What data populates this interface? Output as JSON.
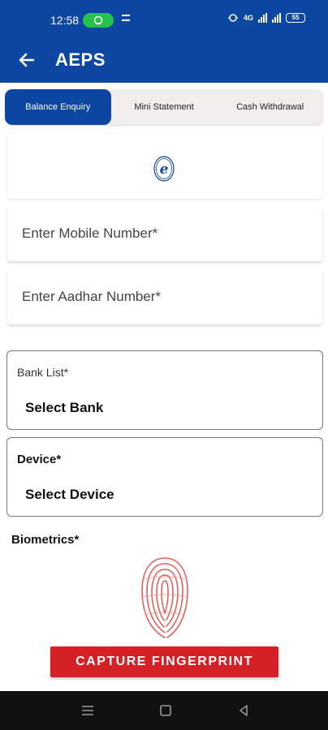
{
  "status_bar": {
    "time": "12:58",
    "network": "4G",
    "battery": "55"
  },
  "app_bar": {
    "title": "AEPS"
  },
  "tabs": [
    {
      "label": "Balance Enquiry",
      "active": true
    },
    {
      "label": "Mini Statement",
      "active": false
    },
    {
      "label": "Cash Withdrawal",
      "active": false
    }
  ],
  "form": {
    "mobile_placeholder": "Enter Mobile Number*",
    "aadhar_placeholder": "Enter Aadhar Number*",
    "bank": {
      "label": "Bank List*",
      "value": "Select Bank"
    },
    "device": {
      "label": "Device*",
      "value": "Select Device"
    },
    "biometrics_label": "Biometrics*",
    "capture_button": "CAPTURE FINGERPRINT"
  },
  "icons": {
    "back": "arrow-left-icon",
    "logo": "e-logo-icon",
    "fingerprint": "fingerprint-icon",
    "hotspot": "hotspot-icon",
    "nav_menu": "menu-icon",
    "nav_home": "square-home-icon",
    "nav_back": "triangle-back-icon"
  },
  "colors": {
    "primary": "#0d47a1",
    "accent": "#d42027",
    "hotspot": "#27c24c"
  }
}
